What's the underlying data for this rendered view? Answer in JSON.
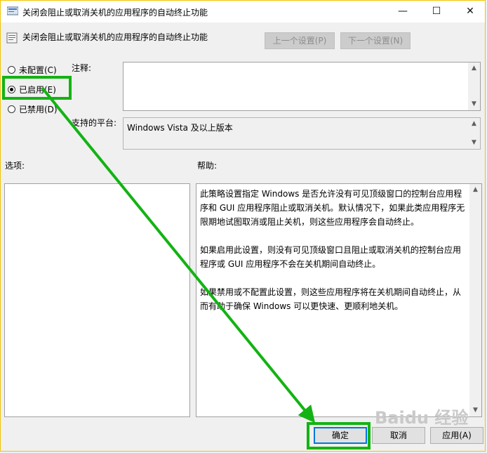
{
  "window": {
    "title": "关闭会阻止或取消关机的应用程序的自动终止功能",
    "minimize_glyph": "—",
    "maximize_glyph": "☐",
    "close_glyph": "✕"
  },
  "header": {
    "title": "关闭会阻止或取消关机的应用程序的自动终止功能",
    "prev_setting": "上一个设置(P)",
    "next_setting": "下一个设置(N)"
  },
  "radios": [
    {
      "label": "未配置(C)",
      "checked": false
    },
    {
      "label": "已启用(E)",
      "checked": true
    },
    {
      "label": "已禁用(D)",
      "checked": false
    }
  ],
  "labels": {
    "comment": "注释:",
    "platform": "支持的平台:",
    "options": "选项:",
    "help": "帮助:"
  },
  "comment_value": "",
  "platform_value": "Windows Vista 及以上版本",
  "help_paragraphs": [
    "此策略设置指定 Windows 是否允许没有可见顶级窗口的控制台应用程序和 GUI 应用程序阻止或取消关机。默认情况下，如果此类应用程序无限期地试图取消或阻止关机，则这些应用程序会自动终止。",
    "如果启用此设置，则没有可见顶级窗口且阻止或取消关机的控制台应用程序或 GUI 应用程序不会在关机期间自动终止。",
    "如果禁用或不配置此设置，则这些应用程序将在关机期间自动终止，从而有助于确保 Windows 可以更快速、更顺利地关机。"
  ],
  "footer": {
    "ok": "确定",
    "cancel": "取消",
    "apply": "应用(A)"
  },
  "watermark": "Baidu 经验",
  "colors": {
    "highlight": "#13b313",
    "title_border": "#f2c400",
    "ok_border": "#0078d7"
  }
}
